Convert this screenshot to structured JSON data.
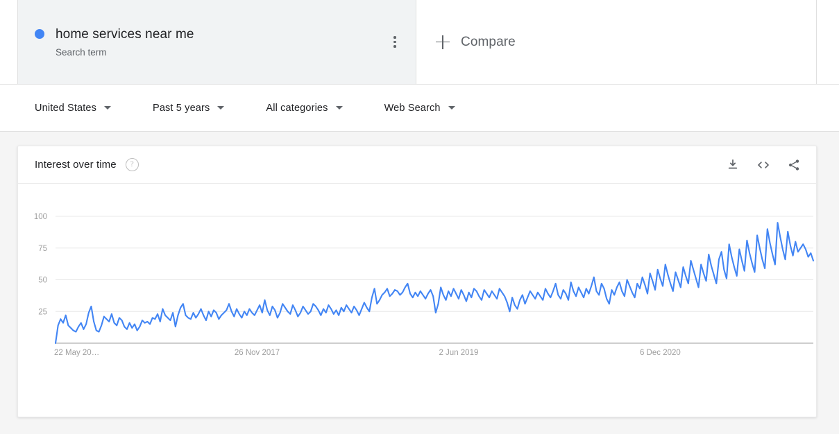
{
  "term_card": {
    "title": "home services near me",
    "subtitle": "Search term",
    "dot_color": "#4285f4",
    "menu_icon": "more-vert-icon"
  },
  "compare": {
    "label": "Compare",
    "icon": "plus-icon"
  },
  "filters": [
    {
      "label": "United States"
    },
    {
      "label": "Past 5 years"
    },
    {
      "label": "All categories"
    },
    {
      "label": "Web Search"
    }
  ],
  "chart_card": {
    "title": "Interest over time",
    "help_icon": "help-circle-icon",
    "help_glyph": "?",
    "actions": [
      {
        "name": "download-icon"
      },
      {
        "name": "embed-icon",
        "glyph": "<>"
      },
      {
        "name": "share-icon"
      }
    ]
  },
  "chart_data": {
    "type": "line",
    "title": "Interest over time",
    "xlabel": "",
    "ylabel": "",
    "ylim": [
      0,
      100
    ],
    "grid": true,
    "legend": false,
    "line_color": "#4285f4",
    "y_ticks": [
      100,
      75,
      50,
      25
    ],
    "x_tick_labels": [
      "22 May 20…",
      "26 Nov 2017",
      "2 Jun 2019",
      "6 Dec 2020"
    ],
    "x_tick_indices": [
      0,
      79,
      158,
      237
    ],
    "series": [
      {
        "name": "home services near me",
        "values": [
          0,
          14,
          19,
          16,
          22,
          14,
          12,
          10,
          9,
          13,
          16,
          11,
          15,
          24,
          29,
          17,
          10,
          9,
          14,
          21,
          19,
          17,
          23,
          16,
          14,
          20,
          18,
          13,
          11,
          16,
          12,
          15,
          10,
          13,
          18,
          16,
          17,
          15,
          20,
          19,
          23,
          17,
          27,
          22,
          20,
          18,
          24,
          13,
          22,
          28,
          31,
          22,
          20,
          19,
          24,
          20,
          23,
          27,
          22,
          18,
          25,
          21,
          26,
          24,
          19,
          22,
          24,
          26,
          31,
          25,
          21,
          27,
          23,
          20,
          25,
          22,
          27,
          24,
          22,
          26,
          30,
          24,
          34,
          26,
          22,
          29,
          26,
          20,
          24,
          31,
          28,
          25,
          23,
          30,
          26,
          21,
          24,
          29,
          26,
          23,
          25,
          31,
          29,
          26,
          22,
          27,
          24,
          30,
          27,
          23,
          26,
          22,
          28,
          25,
          30,
          27,
          24,
          29,
          26,
          22,
          27,
          32,
          28,
          25,
          36,
          43,
          31,
          34,
          38,
          40,
          43,
          37,
          39,
          42,
          41,
          38,
          40,
          44,
          47,
          39,
          36,
          40,
          37,
          41,
          38,
          35,
          39,
          42,
          37,
          24,
          31,
          44,
          38,
          34,
          41,
          37,
          43,
          39,
          35,
          42,
          38,
          33,
          40,
          36,
          43,
          41,
          37,
          34,
          42,
          39,
          36,
          41,
          38,
          35,
          43,
          40,
          37,
          32,
          25,
          36,
          30,
          27,
          34,
          38,
          31,
          36,
          41,
          38,
          35,
          40,
          37,
          34,
          43,
          39,
          36,
          41,
          47,
          38,
          35,
          42,
          39,
          34,
          48,
          41,
          37,
          44,
          40,
          36,
          43,
          39,
          45,
          52,
          41,
          38,
          47,
          43,
          35,
          31,
          42,
          38,
          44,
          48,
          41,
          37,
          50,
          45,
          40,
          36,
          47,
          43,
          52,
          46,
          39,
          55,
          49,
          42,
          58,
          51,
          45,
          62,
          54,
          47,
          41,
          56,
          50,
          44,
          60,
          53,
          47,
          65,
          58,
          51,
          44,
          62,
          55,
          49,
          70,
          61,
          54,
          47,
          66,
          72,
          58,
          51,
          78,
          68,
          60,
          53,
          74,
          65,
          57,
          81,
          71,
          63,
          56,
          85,
          75,
          66,
          59,
          90,
          79,
          70,
          62,
          95,
          84,
          74,
          66,
          88,
          77,
          69,
          80,
          72,
          75,
          78,
          74,
          68,
          71,
          65
        ]
      }
    ]
  }
}
